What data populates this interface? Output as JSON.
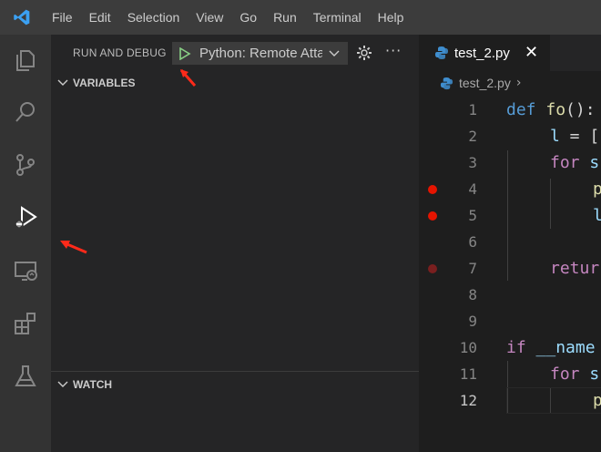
{
  "menu": {
    "logo_icon": "vscode-logo-icon",
    "items": [
      "File",
      "Edit",
      "Selection",
      "View",
      "Go",
      "Run",
      "Terminal",
      "Help"
    ]
  },
  "activity_bar": {
    "icons": [
      "files-icon",
      "search-icon",
      "source-control-icon",
      "run-debug-icon",
      "remote-explorer-icon",
      "extensions-icon",
      "testing-icon"
    ],
    "active": "run-debug-icon"
  },
  "sidebar": {
    "title": "RUN AND DEBUG",
    "configuration": "Python: Remote Attach",
    "sections": {
      "variables": "VARIABLES",
      "watch": "WATCH"
    }
  },
  "editor": {
    "tab_label": "test_2.py",
    "breadcrumb": "test_2.py",
    "lines": [
      {
        "n": "1",
        "text": "def fo():"
      },
      {
        "n": "2",
        "text": "l = ["
      },
      {
        "n": "3",
        "text": "for s"
      },
      {
        "n": "4",
        "text": "p"
      },
      {
        "n": "5",
        "text": "l"
      },
      {
        "n": "6",
        "text": ""
      },
      {
        "n": "7",
        "text": "retur"
      },
      {
        "n": "8",
        "text": ""
      },
      {
        "n": "9",
        "text": ""
      },
      {
        "n": "10",
        "text": "if __name"
      },
      {
        "n": "11",
        "text": "for s"
      },
      {
        "n": "12",
        "text": "p"
      }
    ],
    "breakpoints": [
      "4",
      "5",
      "7"
    ]
  },
  "colors": {
    "breakpoint": "#e51400",
    "annotation_arrow": "#ff2a1a",
    "play_green": "#89d185"
  }
}
